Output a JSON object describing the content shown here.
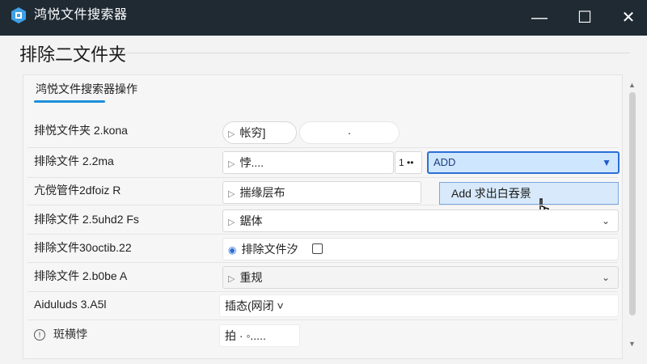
{
  "window": {
    "title": "鸿悦文件搜索器",
    "min_icon": "—",
    "max_icon": "☐",
    "close_icon": "✕"
  },
  "page": {
    "heading": "排除二文件夹"
  },
  "panel": {
    "tab_label": "鸿悦文件搜索器操作"
  },
  "rows": [
    {
      "label": "排悦文件夹 2.kona",
      "field_text": "帐穷]",
      "extra_text": "·"
    },
    {
      "label": "排除文件 2.2ma",
      "field_text": "悖....",
      "small_text": "1 ••",
      "select_value": "ADD"
    },
    {
      "label": "亢傥管件2dfoiz R",
      "field_text": "揣缘层布",
      "dropdown_option": "Add 求出白吞景"
    },
    {
      "label": "排除文件 2.5uhd2 Fs",
      "field_text": "鋸体"
    },
    {
      "label": "排除文件30octib.22",
      "field_text": "排除文件汐"
    },
    {
      "label": "排除文件 2.b0be A",
      "field_text": "重规"
    },
    {
      "label": "Aiduluds 3.A5l",
      "field_text": "插态(网闭 ˅"
    },
    {
      "label": "斑横悖",
      "field_text": "拍 · ◦....."
    }
  ],
  "colors": {
    "titlebar": "#1f2a33",
    "accent": "#1e90d8",
    "select_border": "#2b6fd6",
    "select_fill": "#cfe6ff"
  }
}
